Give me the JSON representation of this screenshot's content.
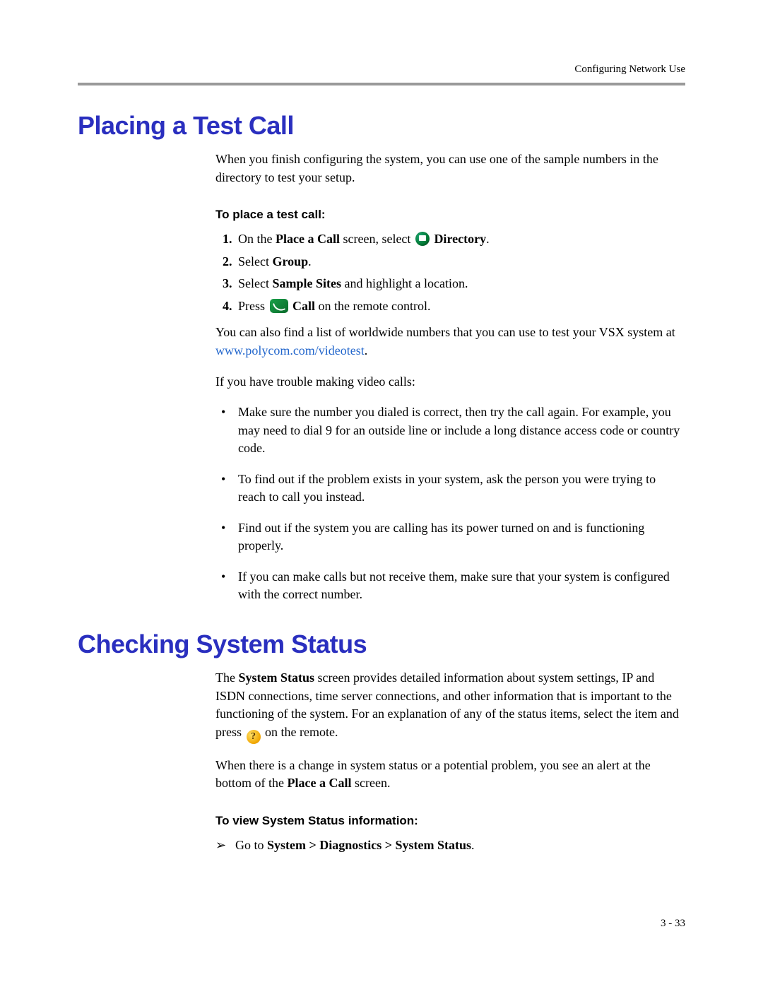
{
  "header": {
    "label": "Configuring Network Use"
  },
  "section1": {
    "heading": "Placing a Test Call",
    "intro": "When you finish configuring the system, you can use one of the sample numbers in the directory to test your setup.",
    "subheading": "To place a test call:",
    "step1_a": "On the ",
    "step1_b": "Place a Call",
    "step1_c": " screen, select ",
    "step1_d": " Directory",
    "step1_e": ".",
    "step2_a": "Select ",
    "step2_b": "Group",
    "step2_c": ".",
    "step3_a": "Select ",
    "step3_b": "Sample Sites",
    "step3_c": " and highlight a location.",
    "step4_a": "Press ",
    "step4_b": " Call",
    "step4_c": " on the remote control.",
    "after1_a": "You can also find a list of worldwide numbers that you can use to test your VSX system at ",
    "after1_link": "www.polycom.com/videotest",
    "after1_b": ".",
    "after2": "If you have trouble making video calls:",
    "bullets": [
      "Make sure the number you dialed is correct, then try the call again. For example, you may need to dial 9 for an outside line or include a long distance access code or country code.",
      "To find out if the problem exists in your system, ask the person you were trying to reach to call you instead.",
      "Find out if the system you are calling has its power turned on and is functioning properly.",
      "If you can make calls but not receive them, make sure that your system is configured with the correct number."
    ]
  },
  "section2": {
    "heading": "Checking System Status",
    "p1_a": "The ",
    "p1_b": "System Status",
    "p1_c": " screen provides detailed information about system settings, IP and ISDN connections, time server connections, and other information that is important to the functioning of the system. For an explanation of any of the status items, select the item and press ",
    "p1_d": " on the remote.",
    "p2_a": "When there is a change in system status or a potential problem, you see an alert at the bottom of the ",
    "p2_b": "Place a Call",
    "p2_c": " screen.",
    "subheading": "To view System Status information:",
    "arrow": "➢",
    "goto_a": "Go to ",
    "goto_b": "System > Diagnostics > System Status",
    "goto_c": "."
  },
  "footer": {
    "page": "3 - 33"
  }
}
